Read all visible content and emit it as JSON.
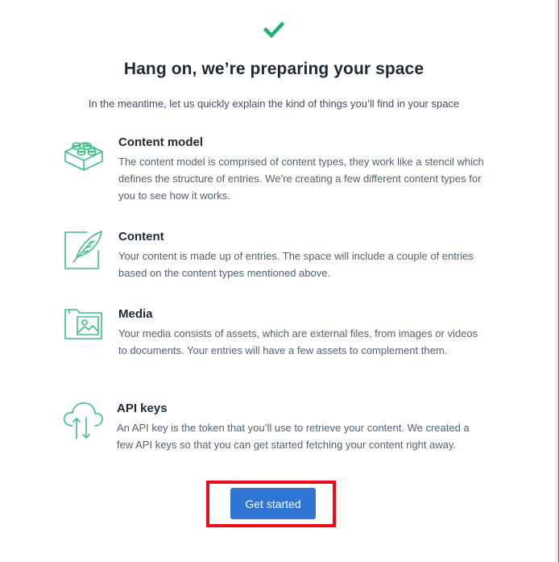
{
  "header": {
    "status_icon": "checkmark-icon",
    "title": "Hang on, we’re preparing your space",
    "subtitle": "In the meantime, let us quickly explain the kind of things you’ll find in your space"
  },
  "features": [
    {
      "icon": "blocks-icon",
      "title": "Content model",
      "description": "The content model is comprised of content types, they work like a stencil which defines the structure of entries. We’re creating a few different content types for you to see how it works."
    },
    {
      "icon": "feather-icon",
      "title": "Content",
      "description": "Your content is made up of entries. The space will include a couple of entries based on the content types mentioned above."
    },
    {
      "icon": "media-folder-icon",
      "title": "Media",
      "description": "Your media consists of assets, which are external files, from images or videos to documents. Your entries will have a few assets to complement them."
    },
    {
      "icon": "cloud-sync-icon",
      "title": "API keys",
      "description": "An API key is the token that you’ll use to retrieve your content. We created a few API keys so that you can get started fetching your content right away."
    }
  ],
  "cta": {
    "label": "Get started"
  },
  "colors": {
    "accent_green": "#1fb06a",
    "icon_green": "#3fbf86",
    "button_blue": "#2e75d4",
    "highlight_red": "#e8111b"
  }
}
